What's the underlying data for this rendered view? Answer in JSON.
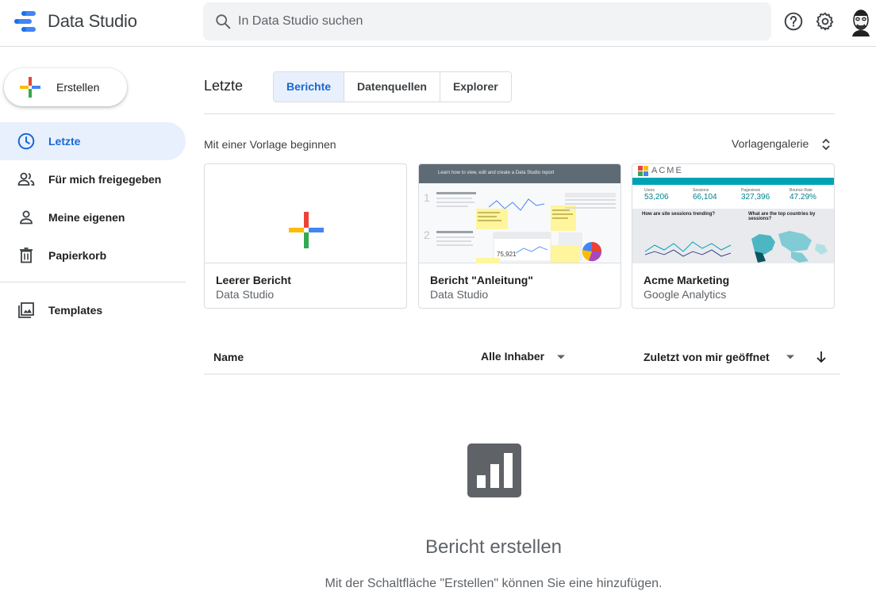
{
  "header": {
    "app_title": "Data Studio",
    "search_placeholder": "In Data Studio suchen",
    "icons": [
      "help-icon",
      "settings-icon",
      "avatar"
    ]
  },
  "sidebar": {
    "create_label": "Erstellen",
    "items": [
      {
        "label": "Letzte",
        "icon": "clock-icon",
        "active": true
      },
      {
        "label": "Für mich freigegeben",
        "icon": "people-icon",
        "active": false
      },
      {
        "label": "Meine eigenen",
        "icon": "person-icon",
        "active": false
      },
      {
        "label": "Papierkorb",
        "icon": "trash-icon",
        "active": false
      },
      {
        "label": "Templates",
        "icon": "image-icon",
        "active": false
      }
    ]
  },
  "main": {
    "title": "Letzte",
    "tabs": [
      {
        "label": "Berichte",
        "active": true
      },
      {
        "label": "Datenquellen",
        "active": false
      },
      {
        "label": "Explorer",
        "active": false
      }
    ],
    "templates_heading": "Mit einer Vorlage beginnen",
    "gallery_label": "Vorlagengalerie",
    "templates": [
      {
        "title": "Leerer Bericht",
        "subtitle": "Data Studio"
      },
      {
        "title": "Bericht \"Anleitung\"",
        "subtitle": "Data Studio",
        "banner": "Learn how to view, edit and create a Data Studio report"
      },
      {
        "title": "Acme Marketing",
        "subtitle": "Google Analytics",
        "brand": "ACME",
        "metrics": [
          {
            "label": "Users",
            "value": "53,206"
          },
          {
            "label": "Sessions",
            "value": "66,104"
          },
          {
            "label": "Pageviews",
            "value": "327,396"
          },
          {
            "label": "Bounce Rate",
            "value": "47.29%"
          }
        ],
        "panel_left": "How are site sessions trending?",
        "panel_right": "What are the top countries by sessions?"
      }
    ],
    "list_header": {
      "name": "Name",
      "owner": "Alle Inhaber",
      "sort": "Zuletzt von mir geöffnet"
    },
    "empty_state": {
      "title": "Bericht erstellen",
      "subtitle": "Mit der Schaltfläche \"Erstellen\" können Sie eine hinzufügen."
    }
  },
  "colors": {
    "accent_blue": "#1967d2",
    "active_bg": "#e8f0fe",
    "google_red": "#ea4335",
    "google_yellow": "#fbbc04",
    "google_green": "#34a853",
    "google_blue": "#4285f4",
    "acme_teal": "#00a3b4"
  }
}
